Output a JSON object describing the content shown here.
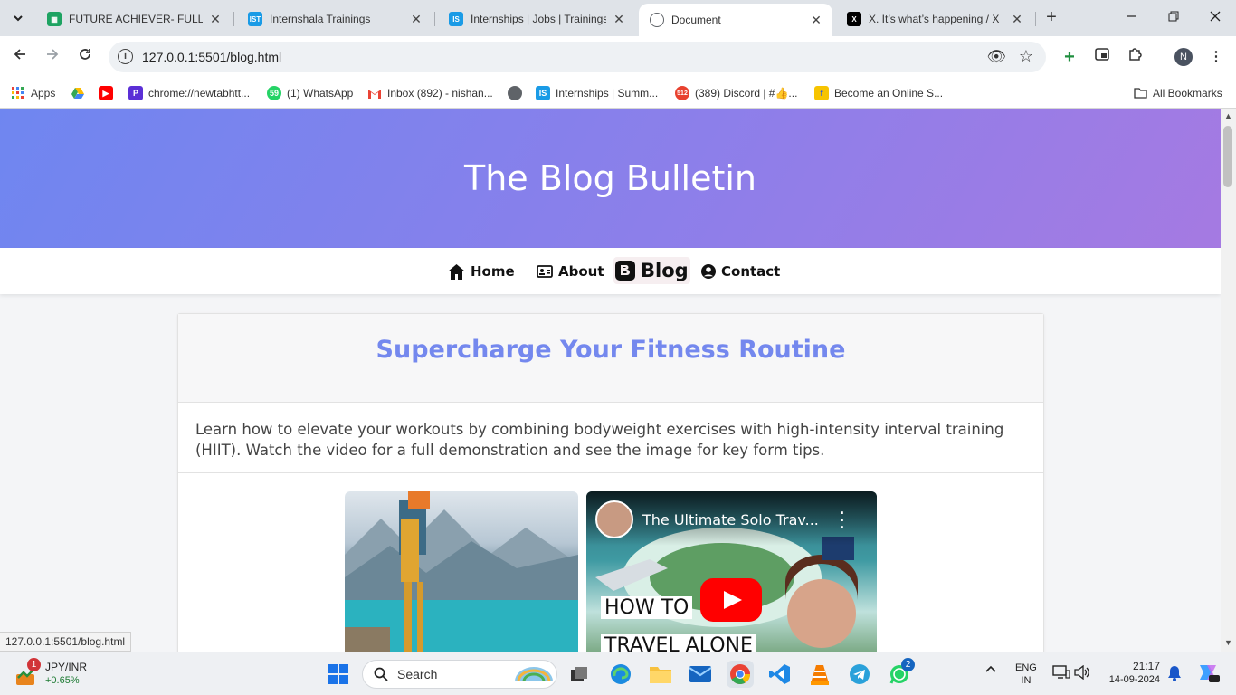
{
  "browser": {
    "tabs": [
      {
        "title": "FUTURE ACHIEVER- FULL STA",
        "favicon": "sheets-icon",
        "color": "#1ea362"
      },
      {
        "title": "Internshala Trainings",
        "favicon": "internshala-icon",
        "color": "#1a9be6"
      },
      {
        "title": "Internships | Jobs | Trainings",
        "favicon": "internshala-icon",
        "color": "#1a9be6"
      },
      {
        "title": "Document",
        "favicon": "globe-icon",
        "color": "#5f6368",
        "active": true
      },
      {
        "title": "X. It’s what’s happening / X",
        "favicon": "x-icon",
        "color": "#000000"
      }
    ],
    "close_glyph": "✕",
    "new_tab_glyph": "+",
    "url": "127.0.0.1:5501/blog.html",
    "profile_initial": "N",
    "status_url": "127.0.0.1:5501/blog.html",
    "bookmarks": [
      {
        "label": "Apps",
        "icon": "apps-grid-icon"
      },
      {
        "label": "",
        "icon": "google-drive-icon"
      },
      {
        "label": "",
        "icon": "youtube-icon"
      },
      {
        "label": "chrome://newtabhtt...",
        "icon": "newtab-icon"
      },
      {
        "label": "(1) WhatsApp",
        "icon": "whatsapp-icon"
      },
      {
        "label": "Inbox (892) - nishan...",
        "icon": "gmail-icon"
      },
      {
        "label": "",
        "icon": "globe-icon"
      },
      {
        "label": "Internships | Summ...",
        "icon": "internshala-icon"
      },
      {
        "label": "(389) Discord | #👍...",
        "icon": "discord-icon"
      },
      {
        "label": "Become an Online S...",
        "icon": "flipkart-icon"
      }
    ],
    "all_bookmarks": "All Bookmarks"
  },
  "page": {
    "site_title": "The Blog Bulletin",
    "nav": [
      {
        "label": "Home",
        "icon": "home-icon"
      },
      {
        "label": "About",
        "icon": "id-card-icon"
      },
      {
        "label": "Blog",
        "icon": "blogger-icon",
        "active": true
      },
      {
        "label": "Contact",
        "icon": "user-circle-icon"
      }
    ],
    "post": {
      "title": "Supercharge Your Fitness Routine",
      "body": "Learn how to elevate your workouts by combining bodyweight exercises with high-intensity interval training (HIIT). Watch the video for a full demonstration and see the image for key form tips.",
      "video_title": "The Ultimate Solo Trav...",
      "video_caption_1": "HOW TO",
      "video_caption_2": "TRAVEL ALONE"
    },
    "colors": {
      "accent": "#7488ee",
      "hero_start": "#6f86f0",
      "hero_end": "#a57ae2"
    }
  },
  "taskbar": {
    "ticker_name": "JPY/INR",
    "ticker_change": "+0.65%",
    "ticker_badge": "1",
    "search_label": "Search",
    "lang_1": "ENG",
    "lang_2": "IN",
    "time": "21:17",
    "date": "14-09-2024",
    "whatsapp_badge": "2"
  }
}
